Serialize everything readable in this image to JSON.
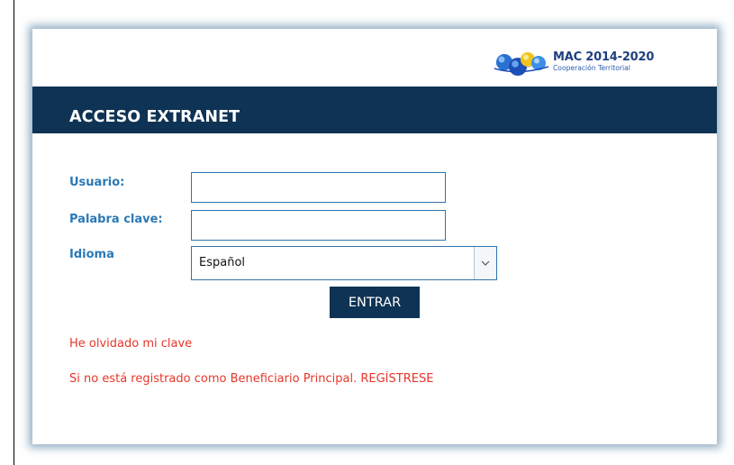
{
  "logo": {
    "title": "MAC 2014-2020",
    "subtitle": "Cooperación Territorial"
  },
  "header": {
    "title": "ACCESO EXTRANET"
  },
  "form": {
    "username_label": "Usuario:",
    "username_value": "",
    "password_label": "Palabra clave:",
    "password_value": "",
    "language_label": "Idioma",
    "language_selected": "Español",
    "submit_label": "ENTRAR"
  },
  "links": {
    "forgot_password": "He olvidado mi clave",
    "register": "Si no está registrado como Beneficiario Principal. REGÍSTRESE"
  },
  "colors": {
    "brand_dark_blue": "#0e3354",
    "label_blue": "#2b79b6",
    "input_border": "#2f74ad",
    "link_red": "#e8362a",
    "card_glow": "#3c6e96"
  },
  "icons": {
    "logo": "mac-globes-logo",
    "dropdown": "chevron-down-icon"
  }
}
